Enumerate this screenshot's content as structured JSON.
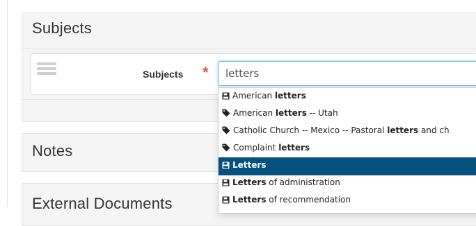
{
  "panels": {
    "subjects_title": "Subjects",
    "notes_title": "Notes",
    "external_title": "External Documents"
  },
  "subject_field": {
    "label": "Subjects",
    "required_marker": "*",
    "input_value": "letters"
  },
  "suggestions": [
    {
      "icon": "floppy-icon",
      "prefix": "American ",
      "bold": "letters",
      "suffix": "",
      "active": false
    },
    {
      "icon": "tag-icon",
      "prefix": "American ",
      "bold": "letters",
      "suffix": " -- Utah",
      "active": false
    },
    {
      "icon": "tag-icon",
      "prefix": "Catholic Church -- Mexico -- Pastoral ",
      "bold": "letters",
      "suffix": " and ch",
      "active": false
    },
    {
      "icon": "tag-icon",
      "prefix": "Complaint ",
      "bold": "letters",
      "suffix": "",
      "active": false
    },
    {
      "icon": "floppy-icon",
      "prefix": "",
      "bold": "Letters",
      "suffix": "",
      "active": true
    },
    {
      "icon": "floppy-icon",
      "prefix": "",
      "bold": "Letters",
      "suffix": " of administration",
      "active": false
    },
    {
      "icon": "floppy-icon",
      "prefix": "",
      "bold": "Letters",
      "suffix": " of recommendation",
      "active": false
    }
  ],
  "colors": {
    "active_item_bg": "#06507d",
    "required_red": "#d9534f",
    "focus_border": "#66afe9"
  }
}
